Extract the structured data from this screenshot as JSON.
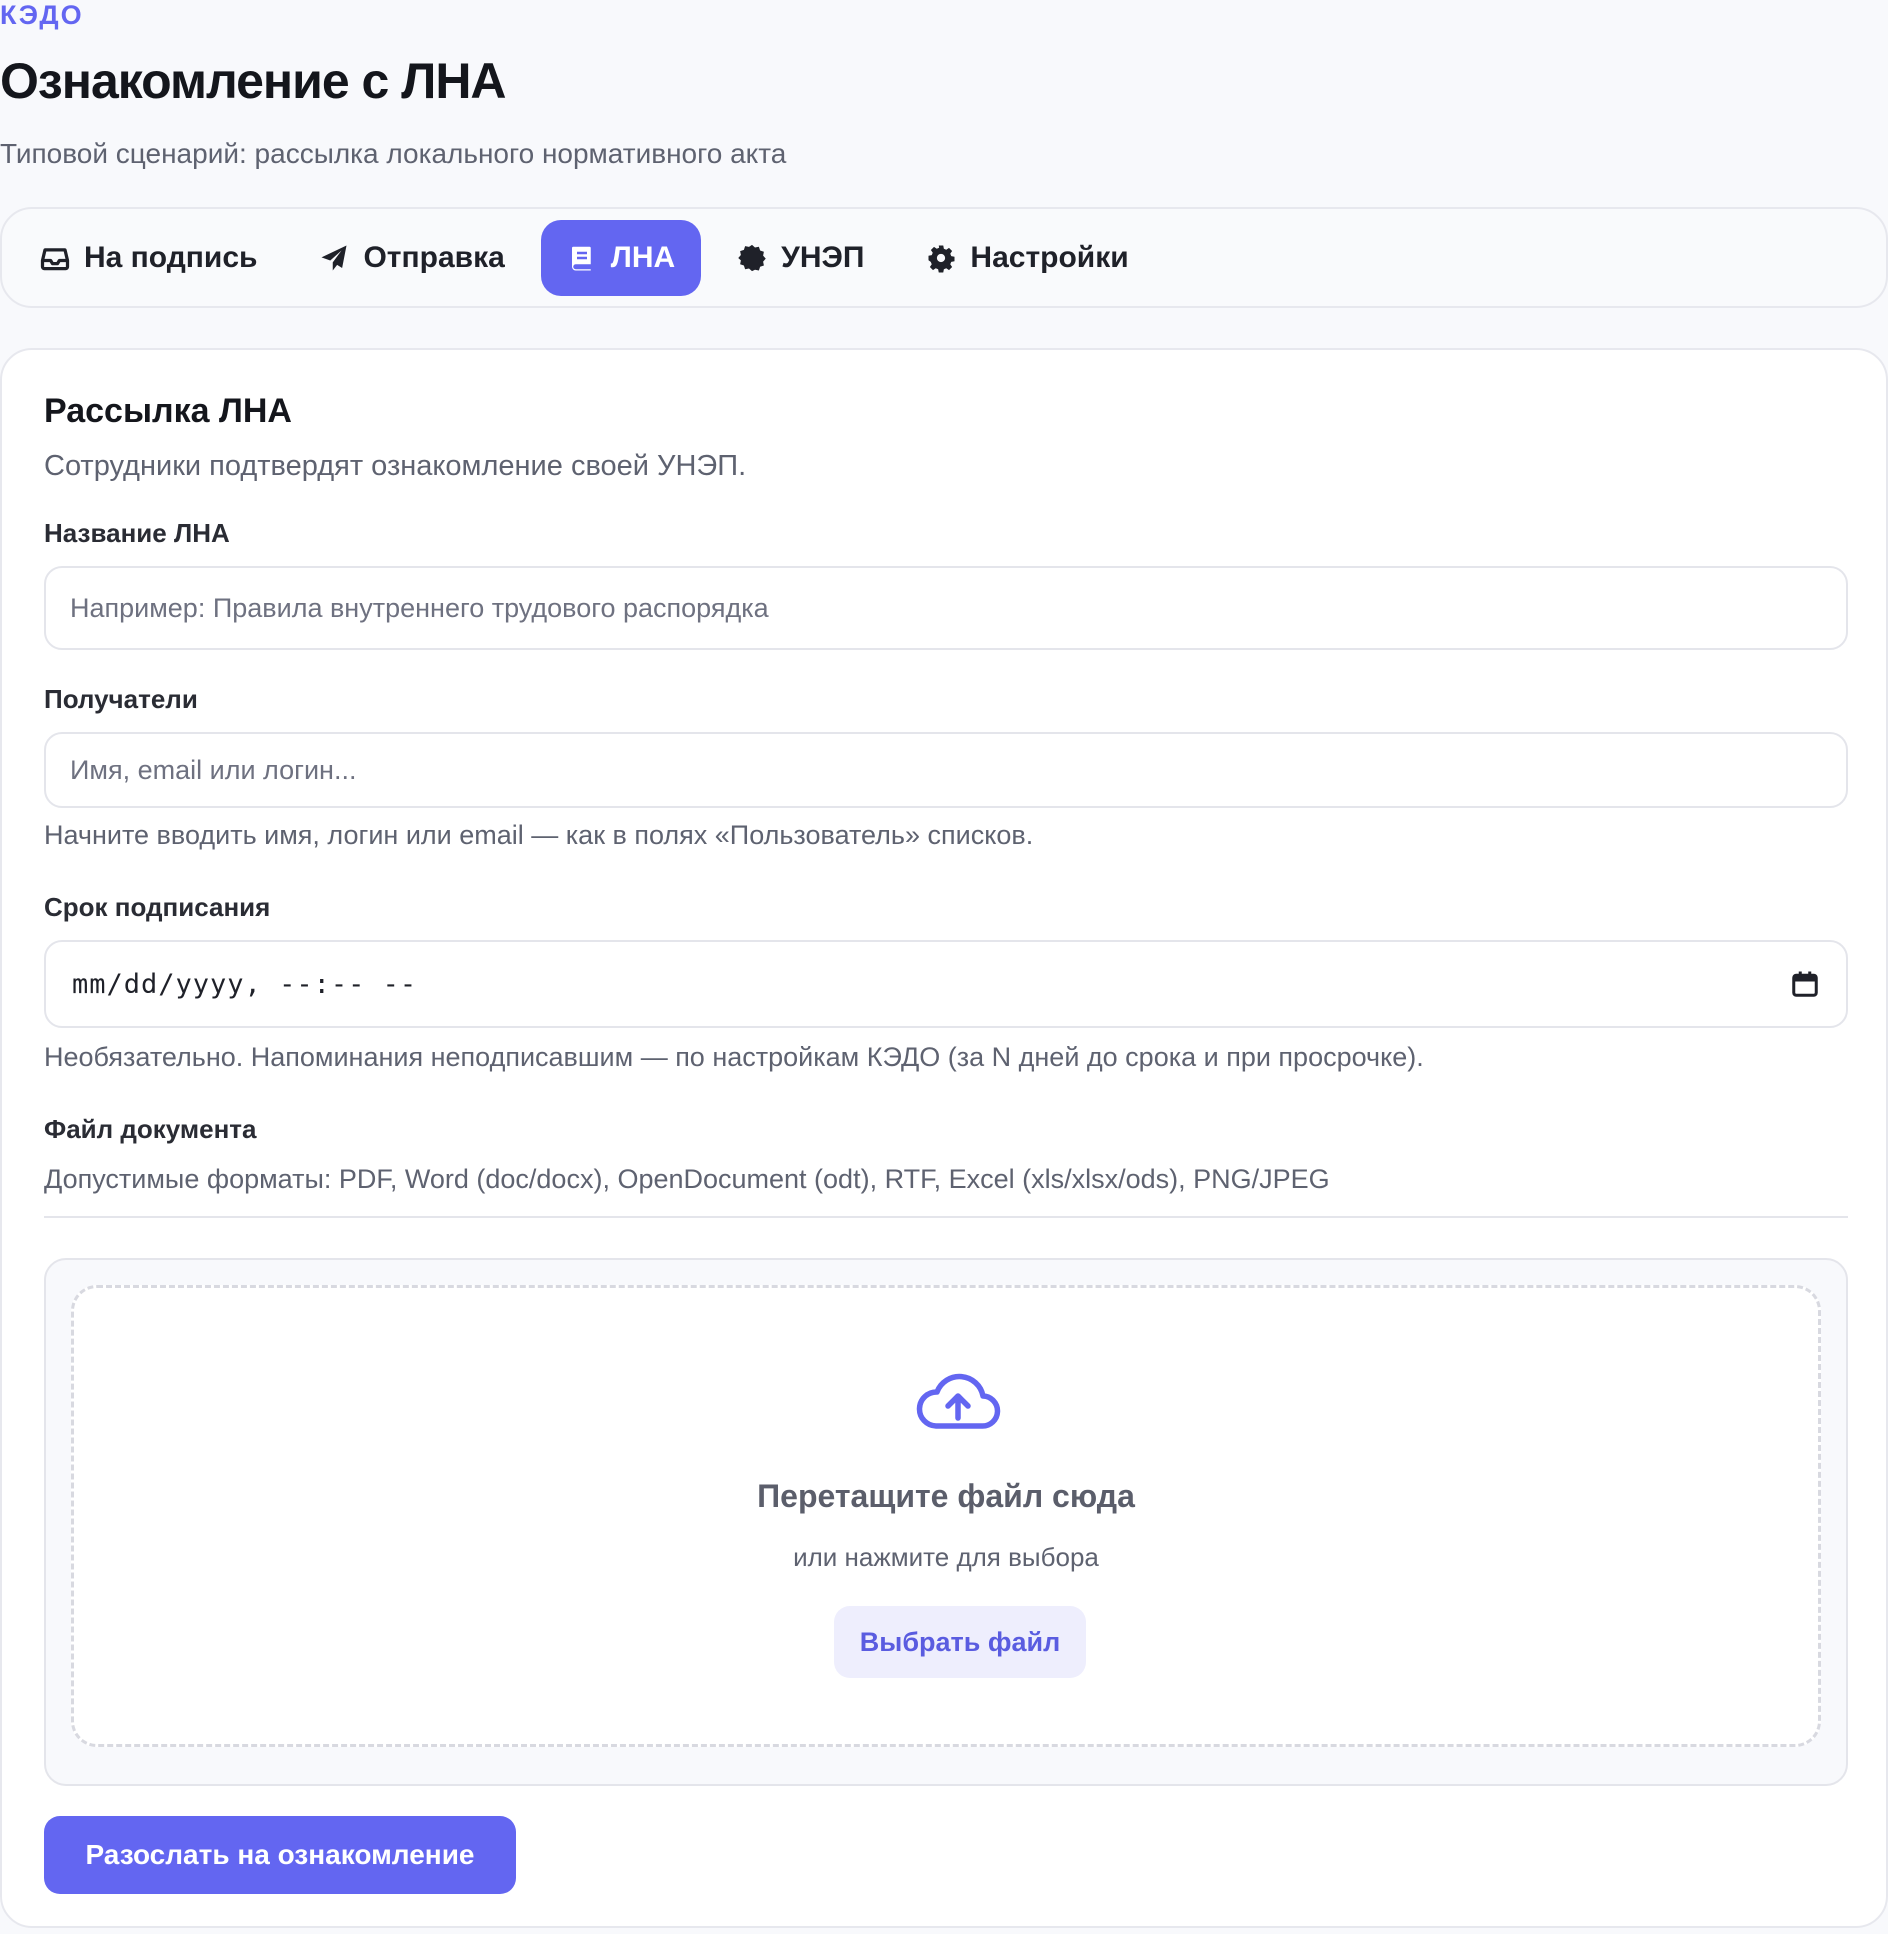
{
  "header": {
    "eyebrow": "кэдо",
    "title": "Ознакомление с ЛНА",
    "subtitle": "Типовой сценарий: рассылка локального нормативного акта"
  },
  "tabs": [
    {
      "label": "На подпись",
      "icon": "inbox-icon",
      "active": false
    },
    {
      "label": "Отправка",
      "icon": "paper-plane-icon",
      "active": false
    },
    {
      "label": "ЛНА",
      "icon": "book-icon",
      "active": true
    },
    {
      "label": "УНЭП",
      "icon": "certificate-icon",
      "active": false
    },
    {
      "label": "Настройки",
      "icon": "gear-icon",
      "active": false
    }
  ],
  "form": {
    "title": "Рассылка ЛНА",
    "description": "Сотрудники подтвердят ознакомление своей УНЭП.",
    "name_field": {
      "label": "Название ЛНА",
      "value": "",
      "placeholder": "Например: Правила внутреннего трудового распорядка"
    },
    "recipients_field": {
      "label": "Получатели",
      "value": "",
      "placeholder": "Имя, email или логин...",
      "hint": "Начните вводить имя, логин или email — как в полях «Пользователь» списков."
    },
    "deadline_field": {
      "label": "Срок подписания",
      "value": "mm/dd/yyyy, --:-- --",
      "hint": "Необязательно. Напоминания неподписавшим — по настройкам КЭДО (за N дней до срока и при просрочке)."
    },
    "file_field": {
      "label": "Файл документа",
      "formats": "Допустимые форматы: PDF, Word (doc/docx), OpenDocument (odt), RTF, Excel (xls/xlsx/ods), PNG/JPEG"
    },
    "dropzone": {
      "icon": "cloud-upload-icon",
      "title": "Перетащите файл сюда",
      "subtitle": "или нажмите для выбора",
      "button_label": "Выбрать файл"
    },
    "submit_label": "Разослать на ознакомление"
  },
  "colors": {
    "accent": "#6366f1",
    "accent_soft": "#eeeefd",
    "background": "#f8f9fc",
    "text_muted": "#5e6270"
  }
}
